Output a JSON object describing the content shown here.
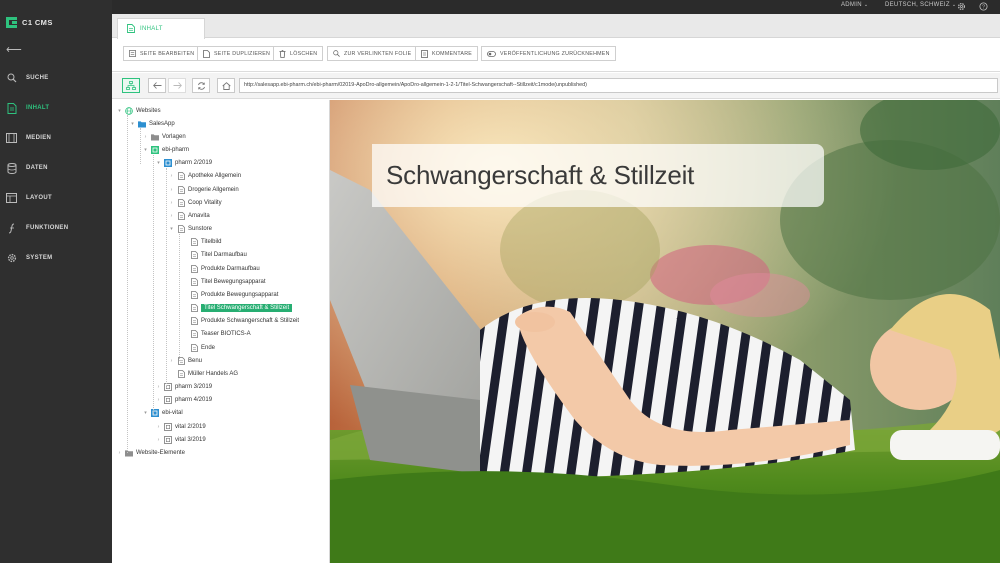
{
  "topbar": {
    "user_label": "ADMIN",
    "language_label": "DEUTSCH, SCHWEIZ"
  },
  "app": {
    "name": "C1 CMS"
  },
  "sidebar": {
    "items": [
      {
        "label": "SUCHE",
        "icon": "search-icon"
      },
      {
        "label": "INHALT",
        "icon": "page-icon"
      },
      {
        "label": "MEDIEN",
        "icon": "media-icon"
      },
      {
        "label": "DATEN",
        "icon": "database-icon"
      },
      {
        "label": "LAYOUT",
        "icon": "layout-icon"
      },
      {
        "label": "FUNKTIONEN",
        "icon": "function-icon"
      },
      {
        "label": "SYSTEM",
        "icon": "gear-icon"
      }
    ],
    "active": "INHALT"
  },
  "tab": {
    "label": "INHALT"
  },
  "toolbar": {
    "edit": "SEITE BEARBEITEN",
    "duplicate": "SEITE DUPLIZIEREN",
    "delete": "LÖSCHEN",
    "linked": "ZUR VERLINKTEN FOLIE",
    "comments": "KOMMENTARE",
    "unpublish": "VERÖFFENTLICHUNG ZURÜCKNEHMEN"
  },
  "url": "http://salesapp.ebi-pharm.ch/ebi-pharm/02019-ApoDro-allgemein/ApoDro-allgemein-1-2-1/Titel-Schwangerschaft--Stillzeit/c1mode(unpublished)",
  "tree": [
    "Websites",
    "SalesApp",
    "Vorlagen",
    "ebi-pharm",
    "pharm 2/2019",
    "Apotheke Allgemein",
    "Drogerie Allgemein",
    "Coop Vitality",
    "Amavita",
    "Sunstore",
    "Titelbild",
    "Titel Darmaufbau",
    "Produkte Darmaufbau",
    "Titel Bewegungsapparat",
    "Produkte Bewegungsapparat",
    "Titel Schwangerschaft & Stillzeit",
    "Produkte Schwangerschaft & Stillzeit",
    "Teaser BIOTICS-A",
    "Ende",
    "Benu",
    "Müller Handels AG",
    "pharm 3/2019",
    "pharm 4/2019",
    "ebi-vital",
    "vital 2/2019",
    "vital 3/2019",
    "Website-Elemente"
  ],
  "preview": {
    "title": "Schwangerschaft & Stillzeit"
  },
  "colors": {
    "accent": "#2ec27e",
    "sidebar": "#2f2f2f",
    "selection": "#27ae72"
  }
}
